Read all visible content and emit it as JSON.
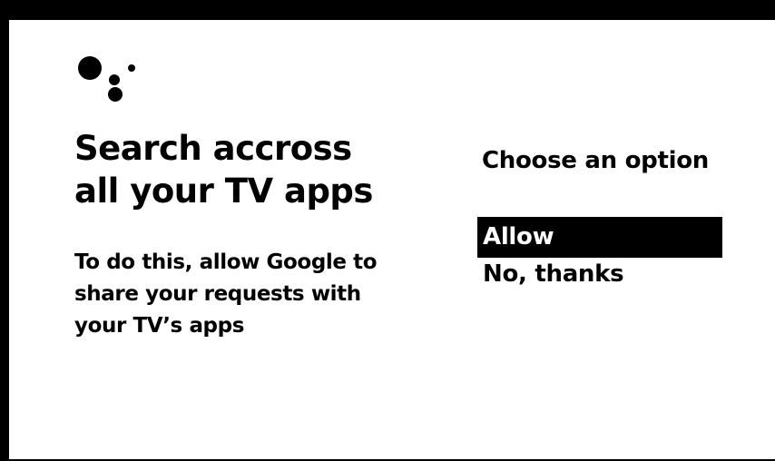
{
  "prompt": {
    "title_line1": "Search accross",
    "title_line2": "all your TV apps",
    "description_line1": "To do this, allow Google to",
    "description_line2": "share your requests with",
    "description_line3": "your TV’s apps"
  },
  "options": {
    "heading": "Choose an option",
    "items": [
      {
        "label": "Allow",
        "selected": true
      },
      {
        "label": "No, thanks",
        "selected": false
      }
    ]
  },
  "logo": {
    "icon": "google-assistant-icon"
  },
  "colors": {
    "background": "#ffffff",
    "frame": "#000000",
    "text": "#000000",
    "selected_background": "#000000",
    "selected_text": "#ffffff"
  }
}
